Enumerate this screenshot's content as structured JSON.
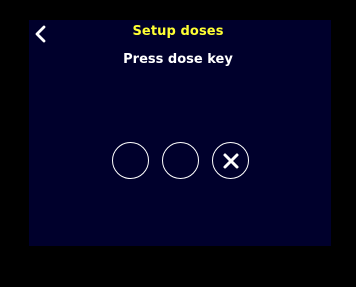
{
  "header": {
    "title": "Setup doses",
    "subtitle": "Press dose key",
    "back_icon": "chevron-left-icon"
  },
  "dose_slots": [
    {
      "state": "empty"
    },
    {
      "state": "empty"
    },
    {
      "state": "clear",
      "icon": "close-icon"
    }
  ],
  "colors": {
    "background": "#000000",
    "screen": "#00002c",
    "title": "#ffff33",
    "text": "#ffffff"
  }
}
